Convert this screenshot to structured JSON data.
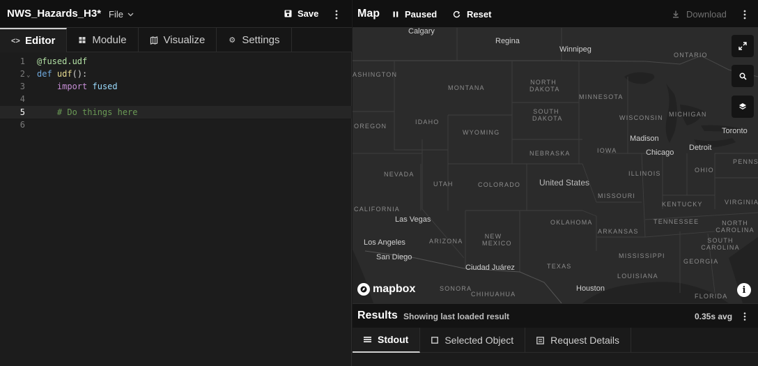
{
  "editor_panel": {
    "udf_name": "NWS_Hazards_H3*",
    "file_menu": "File",
    "save_label": "Save",
    "tabs": [
      {
        "label": "Editor",
        "icon": "code-icon",
        "active": true
      },
      {
        "label": "Module",
        "icon": "grid-icon",
        "active": false
      },
      {
        "label": "Visualize",
        "icon": "map-icon",
        "active": false
      },
      {
        "label": "Settings",
        "icon": "gear-icon",
        "active": false
      }
    ],
    "code_lines": [
      {
        "number": "1",
        "text": "@fused.udf"
      },
      {
        "number": "2",
        "text": "def udf():"
      },
      {
        "number": "3",
        "text": "    import fused"
      },
      {
        "number": "4",
        "text": ""
      },
      {
        "number": "5",
        "text": "    # Do things here"
      },
      {
        "number": "6",
        "text": ""
      }
    ],
    "current_line": 5
  },
  "map_panel": {
    "title": "Map",
    "paused_label": "Paused",
    "reset_label": "Reset",
    "download_label": "Download",
    "controls": [
      "expand-icon",
      "search-icon",
      "layers-icon"
    ],
    "attribution": "mapbox",
    "labels": {
      "country": "United States",
      "states": [
        "ONTARIO",
        "MONTANA",
        "NORTH DAKOTA",
        "MINNESOTA",
        "SOUTH DAKOTA",
        "WISCONSIN",
        "MICHIGAN",
        "IDAHO",
        "WYOMING",
        "OREGON",
        "NEBRASKA",
        "IOWA",
        "NEVADA",
        "UTAH",
        "COLORADO",
        "ILLINOIS",
        "OHIO",
        "PENNSYLVA",
        "MISSOURI",
        "KENTUCKY",
        "VIRGINIA",
        "CALIFORNIA",
        "OKLAHOMA",
        "ARKANSAS",
        "TENNESSEE",
        "NORTH CAROLINA",
        "ARIZONA",
        "NEW MEXICO",
        "SOUTH CAROLINA",
        "MISSISSIPPI",
        "GEORGIA",
        "TEXAS",
        "LOUISIANA",
        "SONORA",
        "CHIHUAHUA",
        "FLORIDA",
        "ASHINGTON"
      ],
      "cities": [
        "Calgary",
        "Regina",
        "Winnipeg",
        "Toronto",
        "Madison",
        "Chicago",
        "Detroit",
        "Las Vegas",
        "Los Angeles",
        "San Diego",
        "Ciudad Juárez",
        "Houston"
      ]
    }
  },
  "results": {
    "title": "Results",
    "subtitle": "Showing last loaded result",
    "avg": "0.35s avg",
    "tabs": [
      {
        "label": "Stdout",
        "icon": "list-icon",
        "active": true
      },
      {
        "label": "Selected Object",
        "icon": "square-icon",
        "active": false
      },
      {
        "label": "Request Details",
        "icon": "receipt-icon",
        "active": false
      }
    ]
  },
  "colors": {
    "background": "#1b1b1b",
    "map_land": "#2b2b2b",
    "keyword": "#6fa8dc",
    "comment": "#6a9955"
  }
}
